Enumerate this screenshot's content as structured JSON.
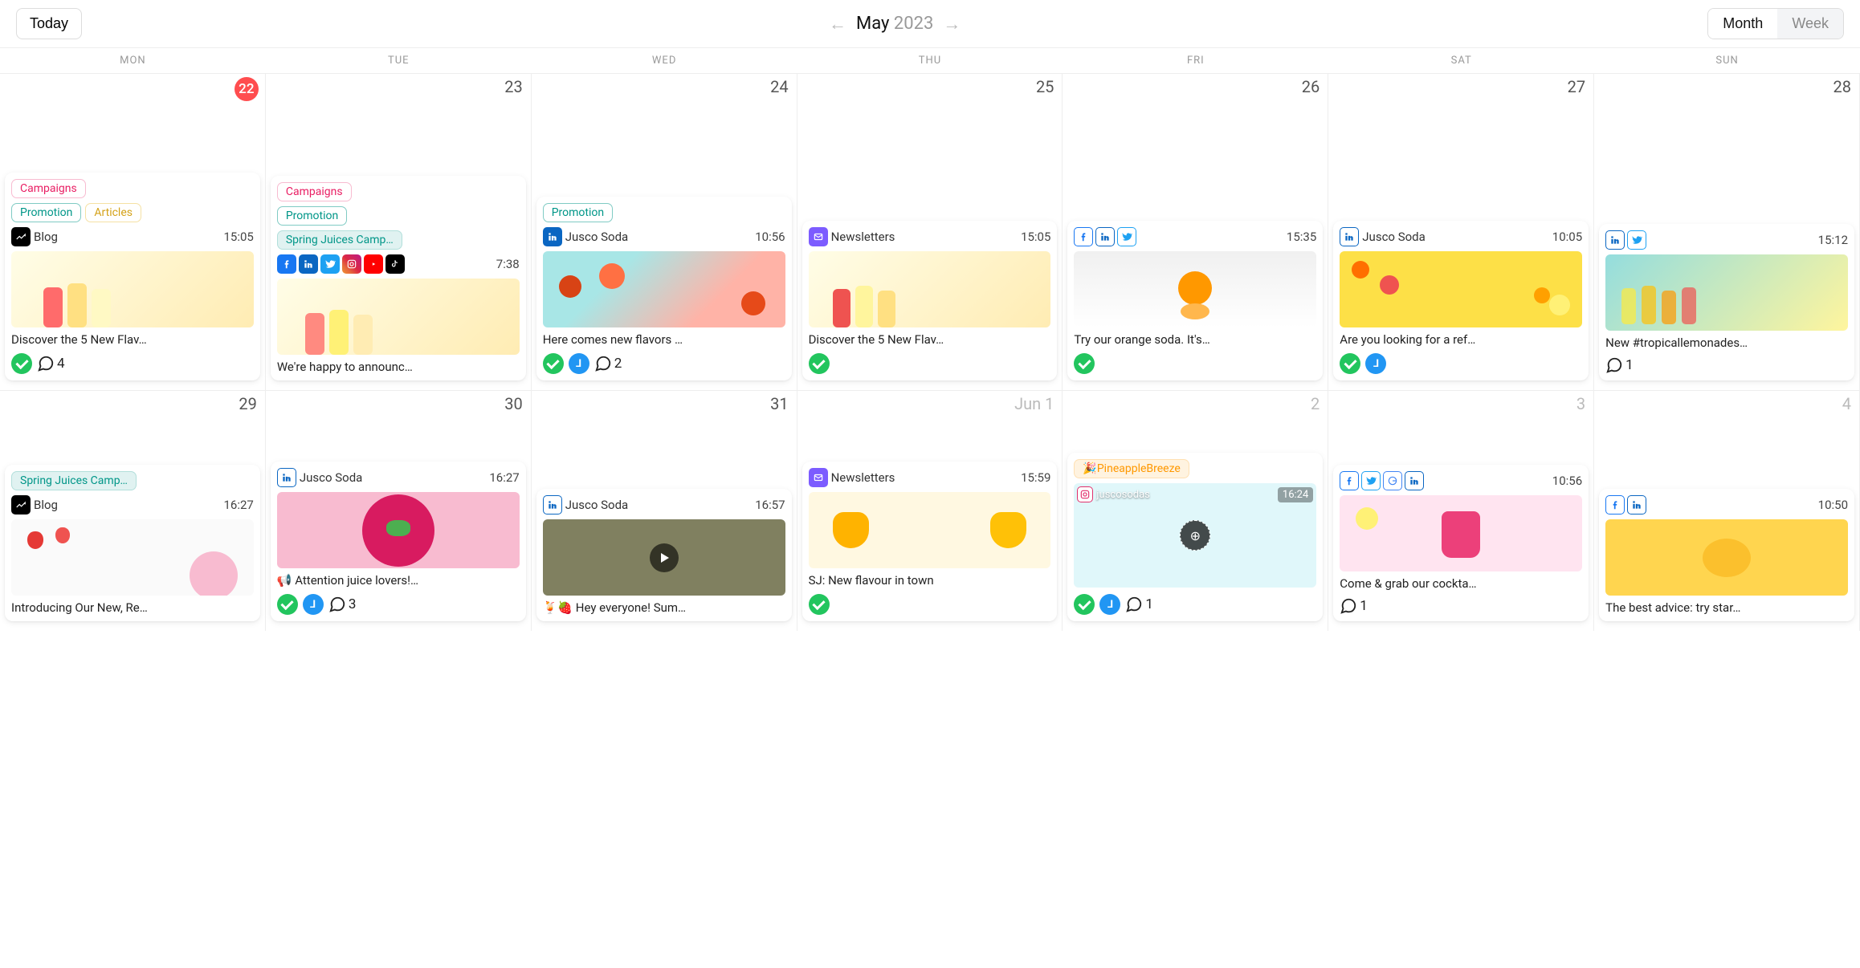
{
  "toolbar": {
    "today": "Today",
    "month_label": "May",
    "year_label": "2023",
    "month_btn": "Month",
    "week_btn": "Week"
  },
  "day_headers": [
    "MON",
    "TUE",
    "WED",
    "THU",
    "FRI",
    "SAT",
    "SUN"
  ],
  "tags": {
    "campaigns": "Campaigns",
    "promotion": "Promotion",
    "articles": "Articles",
    "spring_juices": "Spring Juices Camp…",
    "pineapple": "🎉PineappleBreeze"
  },
  "labels": {
    "blog": "Blog",
    "jusco": "Jusco Soda",
    "newsletters": "Newsletters",
    "juscosodas": "juscosodas"
  },
  "week1": [
    {
      "date": "22",
      "today": true,
      "card": {
        "tags": [
          "campaigns",
          "promotion",
          "articles"
        ],
        "meta_label": "blog",
        "time": "15:05",
        "caption": "Discover the 5 New Flav…",
        "status": [
          "check"
        ],
        "comments": "4"
      }
    },
    {
      "date": "23",
      "card": {
        "tags": [
          "campaigns",
          "promotion",
          "spring_juices"
        ],
        "icons": [
          "fb",
          "li",
          "tw",
          "ig",
          "yt",
          "tk"
        ],
        "time": "7:38",
        "caption": "We're happy to announc…"
      }
    },
    {
      "date": "24",
      "card": {
        "tags": [
          "promotion"
        ],
        "meta_icon": "li",
        "meta_label": "jusco",
        "time": "10:56",
        "caption": "Here comes new flavors …",
        "status": [
          "check",
          "clock"
        ],
        "comments": "2"
      }
    },
    {
      "date": "25",
      "card": {
        "meta_icon": "nl",
        "meta_label": "newsletters",
        "time": "15:05",
        "caption": "Discover the 5 New Flav…",
        "status": [
          "check"
        ]
      }
    },
    {
      "date": "26",
      "card": {
        "icons_bordered": [
          "fb",
          "li",
          "tw"
        ],
        "time": "15:35",
        "caption": "Try our orange soda. It's…",
        "status": [
          "check"
        ]
      }
    },
    {
      "date": "27",
      "card": {
        "meta_icon_b": "li",
        "meta_label": "jusco",
        "time": "10:05",
        "caption": "Are you looking for a ref…",
        "status": [
          "check",
          "clock"
        ]
      }
    },
    {
      "date": "28",
      "card": {
        "icons_bordered": [
          "li",
          "tw"
        ],
        "time": "15:12",
        "caption": "New #tropicallemonades…",
        "comments": "1"
      }
    }
  ],
  "week2": [
    {
      "date": "29",
      "card": {
        "tags": [
          "spring_juices"
        ],
        "meta_label": "blog",
        "time": "16:27",
        "caption": "Introducing Our New, Re…"
      }
    },
    {
      "date": "30",
      "card": {
        "meta_icon_b": "li",
        "meta_label": "jusco",
        "time": "16:27",
        "caption": "📢 Attention juice lovers!…",
        "status": [
          "check",
          "clock"
        ],
        "comments": "3"
      }
    },
    {
      "date": "31",
      "card": {
        "meta_icon_b": "li",
        "meta_label": "jusco",
        "time": "16:57",
        "caption": "🍹🍓 Hey everyone! Sum…"
      }
    },
    {
      "date": "Jun 1",
      "muted": true,
      "card": {
        "meta_icon": "nl",
        "meta_label": "newsletters",
        "time": "15:59",
        "caption": "SJ: New flavour in town",
        "status": [
          "check"
        ]
      }
    },
    {
      "date": "2",
      "muted": true,
      "card": {
        "overlay_tag": "pineapple",
        "overlay_label": "juscosodas",
        "overlay_time": "16:24",
        "status": [
          "check",
          "clock"
        ],
        "comments": "1"
      }
    },
    {
      "date": "3",
      "muted": true,
      "card": {
        "icons_bordered": [
          "fb",
          "tw",
          "gl",
          "li"
        ],
        "time": "10:56",
        "caption": "Come & grab our cockta…",
        "comments": "1"
      }
    },
    {
      "date": "4",
      "muted": true,
      "card": {
        "icons_bordered": [
          "fb",
          "li"
        ],
        "time": "10:50",
        "caption": "The best advice: try star…"
      }
    }
  ]
}
